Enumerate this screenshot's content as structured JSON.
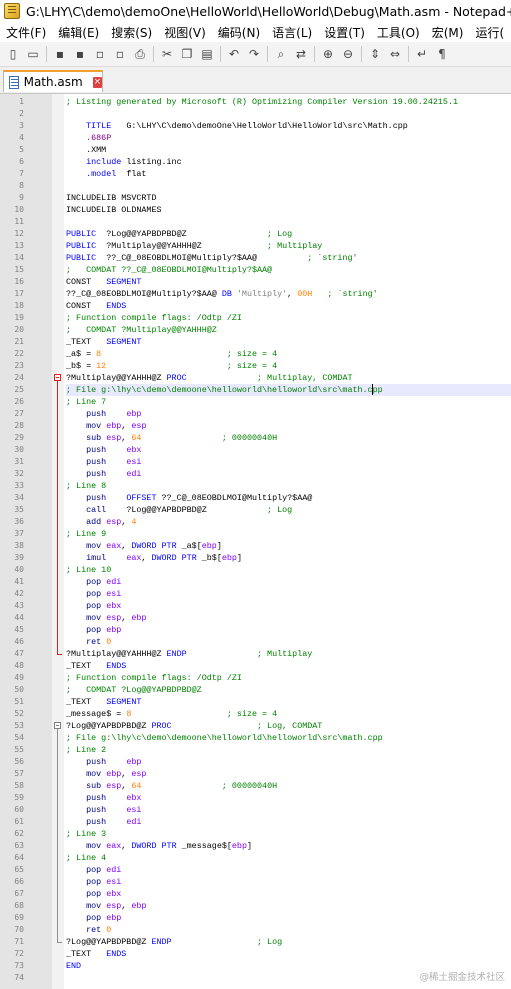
{
  "window": {
    "title": "G:\\LHY\\C\\demo\\demoOne\\HelloWorld\\HelloWorld\\Debug\\Math.asm - Notepad++"
  },
  "menu": {
    "items": [
      "文件(F)",
      "编辑(E)",
      "搜索(S)",
      "视图(V)",
      "编码(N)",
      "语言(L)",
      "设置(T)",
      "工具(O)",
      "宏(M)",
      "运行("
    ]
  },
  "toolbar": {
    "icons": [
      "new-file-icon",
      "open-file-icon",
      "save-icon",
      "save-all-icon",
      "close-icon",
      "close-all-icon",
      "print-icon",
      "cut-icon",
      "copy-icon",
      "paste-icon",
      "undo-icon",
      "redo-icon",
      "find-icon",
      "replace-icon",
      "zoom-in-icon",
      "zoom-out-icon",
      "sync-v-icon",
      "sync-h-icon",
      "wrap-icon",
      "show-all-icon"
    ]
  },
  "tab": {
    "label": "Math.asm",
    "close_glyph": "×"
  },
  "editor": {
    "current_line": 25,
    "lines": [
      [
        [
          "cm",
          "; Listing generated by Microsoft (R) Optimizing Compiler Version 19.00.24215.1"
        ]
      ],
      [],
      [
        [
          "plain",
          "    "
        ],
        [
          "kw",
          "TITLE"
        ],
        [
          "plain",
          "   G:\\LHY\\C\\demo\\demoOne\\HelloWorld\\HelloWorld\\src\\Math.cpp"
        ]
      ],
      [
        [
          "plain",
          "    "
        ],
        [
          "dir",
          ".686P"
        ]
      ],
      [
        [
          "plain",
          "    "
        ],
        [
          "plain",
          ".XMM"
        ]
      ],
      [
        [
          "plain",
          "    "
        ],
        [
          "kw",
          "include"
        ],
        [
          "plain",
          " listing.inc"
        ]
      ],
      [
        [
          "plain",
          "    "
        ],
        [
          "kw",
          ".model"
        ],
        [
          "plain",
          "  flat"
        ]
      ],
      [],
      [
        [
          "plain",
          "INCLUDELIB MSVCRTD"
        ]
      ],
      [
        [
          "plain",
          "INCLUDELIB OLDNAMES"
        ]
      ],
      [],
      [
        [
          "kw",
          "PUBLIC"
        ],
        [
          "plain",
          "  ?Log@@YAPBDPBD@Z"
        ],
        [
          "cm",
          "                ; Log"
        ]
      ],
      [
        [
          "kw",
          "PUBLIC"
        ],
        [
          "plain",
          "  ?Multiplay@@YAHHH@Z"
        ],
        [
          "cm",
          "             ; Multiplay"
        ]
      ],
      [
        [
          "kw",
          "PUBLIC"
        ],
        [
          "plain",
          "  ??_C@_08EOBDLMOI@Multiply?$AA@"
        ],
        [
          "cm",
          "          ; `string'"
        ]
      ],
      [
        [
          "cm",
          ";   COMDAT ??_C@_08EOBDLMOI@Multiply?$AA@"
        ]
      ],
      [
        [
          "plain",
          "CONST   "
        ],
        [
          "kw",
          "SEGMENT"
        ]
      ],
      [
        [
          "plain",
          "??_C@_08EOBDLMOI@Multiply?$AA@ "
        ],
        [
          "kw",
          "DB"
        ],
        [
          "str",
          " 'Multiply'"
        ],
        [
          "plain",
          ", "
        ],
        [
          "num",
          "00H"
        ],
        [
          "cm",
          "   ; `string'"
        ]
      ],
      [
        [
          "plain",
          "CONST   "
        ],
        [
          "kw",
          "ENDS"
        ]
      ],
      [
        [
          "cm",
          "; Function compile flags: /Odtp /ZI"
        ]
      ],
      [
        [
          "cm",
          ";   COMDAT ?Multiplay@@YAHHH@Z"
        ]
      ],
      [
        [
          "plain",
          "_TEXT   "
        ],
        [
          "kw",
          "SEGMENT"
        ]
      ],
      [
        [
          "plain",
          "_a$ = "
        ],
        [
          "num",
          "8"
        ],
        [
          "cm",
          "                         ; size = 4"
        ]
      ],
      [
        [
          "plain",
          "_b$ = "
        ],
        [
          "num",
          "12"
        ],
        [
          "cm",
          "                        ; size = 4"
        ]
      ],
      [
        [
          "plain",
          "?Multiplay@@YAHHH@Z "
        ],
        [
          "kw",
          "PROC"
        ],
        [
          "cm",
          "              ; Multiplay, COMDAT"
        ]
      ],
      [
        [
          "cm",
          "; File g:\\lhy\\c\\demo\\demoone\\helloworld\\helloworld\\src\\math.cpp"
        ]
      ],
      [
        [
          "cm",
          "; Line 7"
        ]
      ],
      [
        [
          "plain",
          "    "
        ],
        [
          "op",
          "push"
        ],
        [
          "plain",
          "    "
        ],
        [
          "reg",
          "ebp"
        ]
      ],
      [
        [
          "plain",
          "    "
        ],
        [
          "op",
          "mov"
        ],
        [
          "plain",
          " "
        ],
        [
          "reg",
          "ebp"
        ],
        [
          "plain",
          ", "
        ],
        [
          "reg",
          "esp"
        ]
      ],
      [
        [
          "plain",
          "    "
        ],
        [
          "op",
          "sub"
        ],
        [
          "plain",
          " "
        ],
        [
          "reg",
          "esp"
        ],
        [
          "plain",
          ", "
        ],
        [
          "num",
          "64"
        ],
        [
          "cm",
          "                ; 00000040H"
        ]
      ],
      [
        [
          "plain",
          "    "
        ],
        [
          "op",
          "push"
        ],
        [
          "plain",
          "    "
        ],
        [
          "reg",
          "ebx"
        ]
      ],
      [
        [
          "plain",
          "    "
        ],
        [
          "op",
          "push"
        ],
        [
          "plain",
          "    "
        ],
        [
          "reg",
          "esi"
        ]
      ],
      [
        [
          "plain",
          "    "
        ],
        [
          "op",
          "push"
        ],
        [
          "plain",
          "    "
        ],
        [
          "reg",
          "edi"
        ]
      ],
      [
        [
          "cm",
          "; Line 8"
        ]
      ],
      [
        [
          "plain",
          "    "
        ],
        [
          "op",
          "push"
        ],
        [
          "plain",
          "    "
        ],
        [
          "kw",
          "OFFSET"
        ],
        [
          "plain",
          " ??_C@_08EOBDLMOI@Multiply?$AA@"
        ]
      ],
      [
        [
          "plain",
          "    "
        ],
        [
          "op",
          "call"
        ],
        [
          "plain",
          "    ?Log@@YAPBDPBD@Z"
        ],
        [
          "cm",
          "            ; Log"
        ]
      ],
      [
        [
          "plain",
          "    "
        ],
        [
          "op",
          "add"
        ],
        [
          "plain",
          " "
        ],
        [
          "reg",
          "esp"
        ],
        [
          "plain",
          ", "
        ],
        [
          "num",
          "4"
        ]
      ],
      [
        [
          "cm",
          "; Line 9"
        ]
      ],
      [
        [
          "plain",
          "    "
        ],
        [
          "op",
          "mov"
        ],
        [
          "plain",
          " "
        ],
        [
          "reg",
          "eax"
        ],
        [
          "plain",
          ", "
        ],
        [
          "kw",
          "DWORD"
        ],
        [
          "plain",
          " "
        ],
        [
          "kw",
          "PTR"
        ],
        [
          "plain",
          " _a$["
        ],
        [
          "reg",
          "ebp"
        ],
        [
          "plain",
          "]"
        ]
      ],
      [
        [
          "plain",
          "    "
        ],
        [
          "op",
          "imul"
        ],
        [
          "plain",
          "    "
        ],
        [
          "reg",
          "eax"
        ],
        [
          "plain",
          ", "
        ],
        [
          "kw",
          "DWORD"
        ],
        [
          "plain",
          " "
        ],
        [
          "kw",
          "PTR"
        ],
        [
          "plain",
          " _b$["
        ],
        [
          "reg",
          "ebp"
        ],
        [
          "plain",
          "]"
        ]
      ],
      [
        [
          "cm",
          "; Line 10"
        ]
      ],
      [
        [
          "plain",
          "    "
        ],
        [
          "op",
          "pop"
        ],
        [
          "plain",
          " "
        ],
        [
          "reg",
          "edi"
        ]
      ],
      [
        [
          "plain",
          "    "
        ],
        [
          "op",
          "pop"
        ],
        [
          "plain",
          " "
        ],
        [
          "reg",
          "esi"
        ]
      ],
      [
        [
          "plain",
          "    "
        ],
        [
          "op",
          "pop"
        ],
        [
          "plain",
          " "
        ],
        [
          "reg",
          "ebx"
        ]
      ],
      [
        [
          "plain",
          "    "
        ],
        [
          "op",
          "mov"
        ],
        [
          "plain",
          " "
        ],
        [
          "reg",
          "esp"
        ],
        [
          "plain",
          ", "
        ],
        [
          "reg",
          "ebp"
        ]
      ],
      [
        [
          "plain",
          "    "
        ],
        [
          "op",
          "pop"
        ],
        [
          "plain",
          " "
        ],
        [
          "reg",
          "ebp"
        ]
      ],
      [
        [
          "plain",
          "    "
        ],
        [
          "op",
          "ret"
        ],
        [
          "plain",
          " "
        ],
        [
          "num",
          "0"
        ]
      ],
      [
        [
          "plain",
          "?Multiplay@@YAHHH@Z "
        ],
        [
          "kw",
          "ENDP"
        ],
        [
          "cm",
          "              ; Multiplay"
        ]
      ],
      [
        [
          "plain",
          "_TEXT   "
        ],
        [
          "kw",
          "ENDS"
        ]
      ],
      [
        [
          "cm",
          "; Function compile flags: /Odtp /ZI"
        ]
      ],
      [
        [
          "cm",
          ";   COMDAT ?Log@@YAPBDPBD@Z"
        ]
      ],
      [
        [
          "plain",
          "_TEXT   "
        ],
        [
          "kw",
          "SEGMENT"
        ]
      ],
      [
        [
          "plain",
          "_message$ = "
        ],
        [
          "num",
          "8"
        ],
        [
          "cm",
          "                   ; size = 4"
        ]
      ],
      [
        [
          "plain",
          "?Log@@YAPBDPBD@Z "
        ],
        [
          "kw",
          "PROC"
        ],
        [
          "cm",
          "                 ; Log, COMDAT"
        ]
      ],
      [
        [
          "cm",
          "; File g:\\lhy\\c\\demo\\demoone\\helloworld\\helloworld\\src\\math.cpp"
        ]
      ],
      [
        [
          "cm",
          "; Line 2"
        ]
      ],
      [
        [
          "plain",
          "    "
        ],
        [
          "op",
          "push"
        ],
        [
          "plain",
          "    "
        ],
        [
          "reg",
          "ebp"
        ]
      ],
      [
        [
          "plain",
          "    "
        ],
        [
          "op",
          "mov"
        ],
        [
          "plain",
          " "
        ],
        [
          "reg",
          "ebp"
        ],
        [
          "plain",
          ", "
        ],
        [
          "reg",
          "esp"
        ]
      ],
      [
        [
          "plain",
          "    "
        ],
        [
          "op",
          "sub"
        ],
        [
          "plain",
          " "
        ],
        [
          "reg",
          "esp"
        ],
        [
          "plain",
          ", "
        ],
        [
          "num",
          "64"
        ],
        [
          "cm",
          "                ; 00000040H"
        ]
      ],
      [
        [
          "plain",
          "    "
        ],
        [
          "op",
          "push"
        ],
        [
          "plain",
          "    "
        ],
        [
          "reg",
          "ebx"
        ]
      ],
      [
        [
          "plain",
          "    "
        ],
        [
          "op",
          "push"
        ],
        [
          "plain",
          "    "
        ],
        [
          "reg",
          "esi"
        ]
      ],
      [
        [
          "plain",
          "    "
        ],
        [
          "op",
          "push"
        ],
        [
          "plain",
          "    "
        ],
        [
          "reg",
          "edi"
        ]
      ],
      [
        [
          "cm",
          "; Line 3"
        ]
      ],
      [
        [
          "plain",
          "    "
        ],
        [
          "op",
          "mov"
        ],
        [
          "plain",
          " "
        ],
        [
          "reg",
          "eax"
        ],
        [
          "plain",
          ", "
        ],
        [
          "kw",
          "DWORD"
        ],
        [
          "plain",
          " "
        ],
        [
          "kw",
          "PTR"
        ],
        [
          "plain",
          " _message$["
        ],
        [
          "reg",
          "ebp"
        ],
        [
          "plain",
          "]"
        ]
      ],
      [
        [
          "cm",
          "; Line 4"
        ]
      ],
      [
        [
          "plain",
          "    "
        ],
        [
          "op",
          "pop"
        ],
        [
          "plain",
          " "
        ],
        [
          "reg",
          "edi"
        ]
      ],
      [
        [
          "plain",
          "    "
        ],
        [
          "op",
          "pop"
        ],
        [
          "plain",
          " "
        ],
        [
          "reg",
          "esi"
        ]
      ],
      [
        [
          "plain",
          "    "
        ],
        [
          "op",
          "pop"
        ],
        [
          "plain",
          " "
        ],
        [
          "reg",
          "ebx"
        ]
      ],
      [
        [
          "plain",
          "    "
        ],
        [
          "op",
          "mov"
        ],
        [
          "plain",
          " "
        ],
        [
          "reg",
          "esp"
        ],
        [
          "plain",
          ", "
        ],
        [
          "reg",
          "ebp"
        ]
      ],
      [
        [
          "plain",
          "    "
        ],
        [
          "op",
          "pop"
        ],
        [
          "plain",
          " "
        ],
        [
          "reg",
          "ebp"
        ]
      ],
      [
        [
          "plain",
          "    "
        ],
        [
          "op",
          "ret"
        ],
        [
          "plain",
          " "
        ],
        [
          "num",
          "0"
        ]
      ],
      [
        [
          "plain",
          "?Log@@YAPBDPBD@Z "
        ],
        [
          "kw",
          "ENDP"
        ],
        [
          "cm",
          "                 ; Log"
        ]
      ],
      [
        [
          "plain",
          "_TEXT   "
        ],
        [
          "kw",
          "ENDS"
        ]
      ],
      [
        [
          "kw",
          "END"
        ]
      ],
      []
    ],
    "folds": [
      {
        "start": 24,
        "end": 47,
        "active": true
      },
      {
        "start": 53,
        "end": 71,
        "active": false
      }
    ]
  },
  "watermark": "@稀土掘金技术社区",
  "colors": {
    "comment": "#008000",
    "keyword": "#0000ff",
    "number": "#ff8000",
    "instruction": "#000080",
    "register": "#8000ff",
    "current_line_bg": "#e8e8ff",
    "fold_active": "#e02020",
    "tab_accent": "#f0a030"
  }
}
